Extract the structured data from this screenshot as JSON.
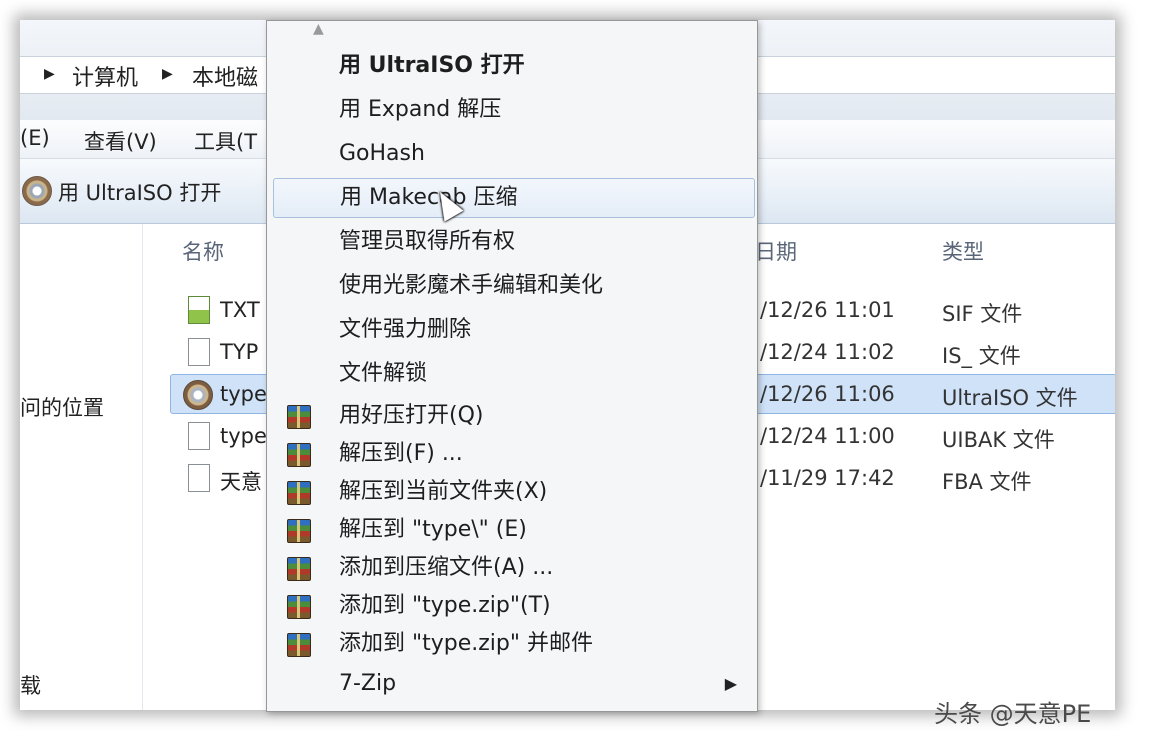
{
  "explorer": {
    "breadcrumb": [
      "计算机",
      "本地磁"
    ],
    "menubar": [
      "(E)",
      "查看(V)",
      "工具(T"
    ],
    "toolbar_open": "用 UltraISO 打开",
    "nav_items": [
      "问的位置",
      "载"
    ],
    "columns": {
      "name": "名称",
      "date": "日期",
      "type": "类型"
    },
    "files": [
      {
        "name": "TXT",
        "date": "/12/26 11:01",
        "type": "SIF 文件",
        "icon": "sif-file-icon"
      },
      {
        "name": "TYP",
        "date": "/12/24 11:02",
        "type": "IS_ 文件",
        "icon": "file-icon"
      },
      {
        "name": "type",
        "date": "/12/26 11:06",
        "type": "UltraISO 文件",
        "icon": "ultraiso-icon",
        "selected": true
      },
      {
        "name": "type",
        "date": "/12/24 11:00",
        "type": "UIBAK 文件",
        "icon": "file-icon"
      },
      {
        "name": "天意",
        "date": "/11/29 17:42",
        "type": "FBA 文件",
        "icon": "file-icon"
      }
    ]
  },
  "context_menu": {
    "items": [
      {
        "label": "用 UltraISO 打开",
        "bold": true
      },
      {
        "label": "用 Expand 解压"
      },
      {
        "label": "GoHash"
      },
      {
        "label": "用 Makecab 压缩",
        "hover": true
      },
      {
        "label": "管理员取得所有权"
      },
      {
        "label": "使用光影魔术手编辑和美化"
      },
      {
        "label": "文件强力删除"
      },
      {
        "label": "文件解锁"
      },
      {
        "label": "用好压打开(Q)",
        "icon": "haozip-icon"
      },
      {
        "label": "解压到(F) ...",
        "icon": "haozip-icon"
      },
      {
        "label": "解压到当前文件夹(X)",
        "icon": "haozip-icon"
      },
      {
        "label": "解压到 \"type\\\" (E)",
        "icon": "haozip-icon"
      },
      {
        "label": "添加到压缩文件(A) ...",
        "icon": "haozip-icon"
      },
      {
        "label": "添加到 \"type.zip\"(T)",
        "icon": "haozip-icon"
      },
      {
        "label": "添加到 \"type.zip\" 并邮件",
        "icon": "haozip-icon"
      },
      {
        "label": "7-Zip",
        "submenu": true
      }
    ],
    "submenu_glyph": "▶",
    "scroll_up_glyph": "▲"
  },
  "watermark": "头条 @天意PE"
}
